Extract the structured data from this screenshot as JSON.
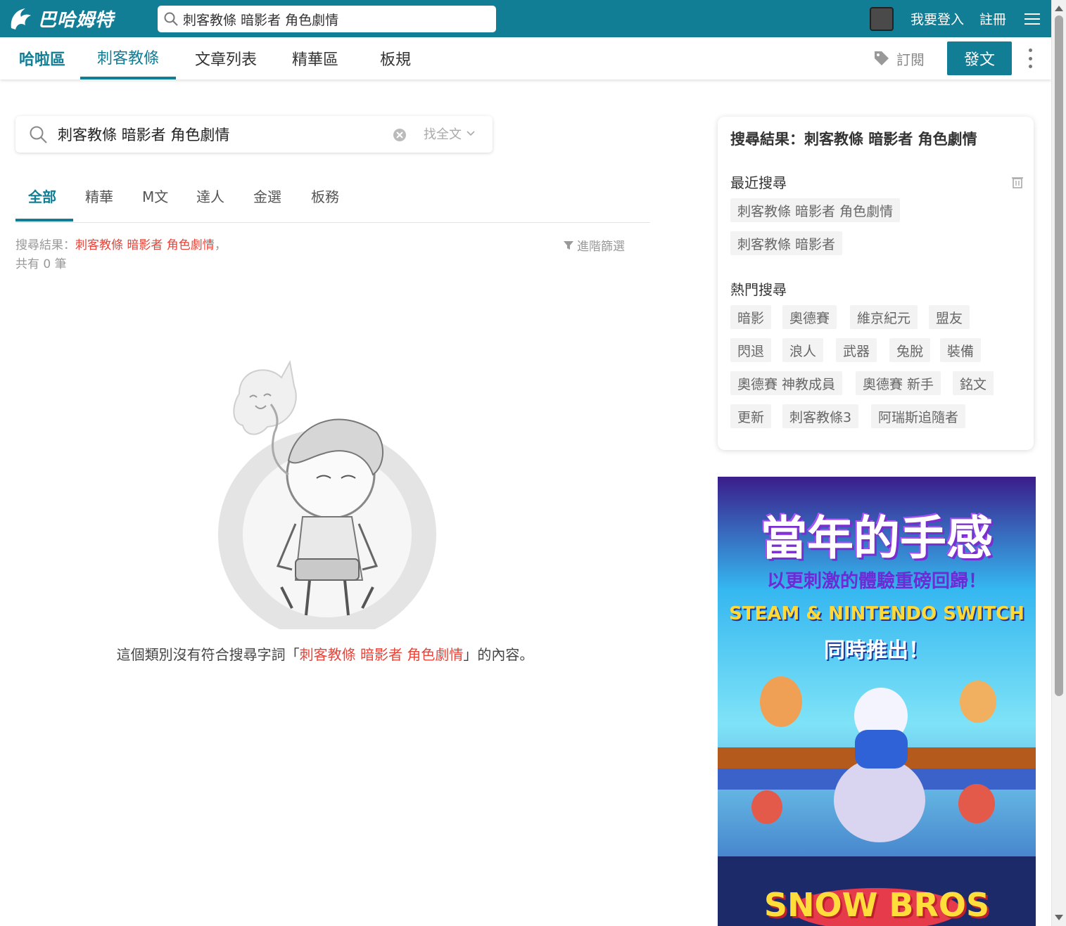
{
  "header": {
    "logo_text": "巴哈姆特",
    "search_value": "刺客教條 暗影者 角色劇情",
    "login": "我要登入",
    "register": "註冊"
  },
  "board_nav": {
    "home": "哈啦區",
    "board_name": "刺客教條",
    "article_list": "文章列表",
    "digest": "精華區",
    "rules": "板規",
    "subscribe": "訂閱",
    "post": "發文"
  },
  "search": {
    "query": "刺客教條 暗影者 角色劇情",
    "scope": "找全文"
  },
  "tabs": [
    "全部",
    "精華",
    "M文",
    "達人",
    "金選",
    "板務"
  ],
  "result_summary": {
    "prefix": "搜尋結果：",
    "keyword": "刺客教條 暗影者 角色劇情",
    "suffix": "，",
    "count_text": "共有 0 筆"
  },
  "advanced_filter": "進階篩選",
  "empty_message": {
    "before": "這個類別沒有符合搜尋字詞「",
    "keyword": "刺客教條 暗影者 角色劇情",
    "after": "」的內容。"
  },
  "side_panel": {
    "title": "搜尋結果：刺客教條 暗影者 角色劇情",
    "recent_title": "最近搜尋",
    "recent": [
      "刺客教條 暗影者 角色劇情",
      "刺客教條 暗影者"
    ],
    "hot_title": "熱門搜尋",
    "hot": [
      "暗影",
      "奧德賽",
      "維京紀元",
      "盟友",
      "閃退",
      "浪人",
      "武器",
      "兔脫",
      "裝備",
      "奧德賽 神教成員",
      "奧德賽 新手",
      "銘文",
      "更新",
      "刺客教條3",
      "阿瑞斯追隨者"
    ]
  },
  "ad": {
    "headline": "當年的手感",
    "subline": "以更刺激的體驗重磅回歸！",
    "platforms": "STEAM & NINTENDO SWITCH",
    "release": "同時推出！",
    "game": "SNOW BROS"
  },
  "colors": {
    "brand": "#117e96",
    "keyword": "#e8443a"
  }
}
